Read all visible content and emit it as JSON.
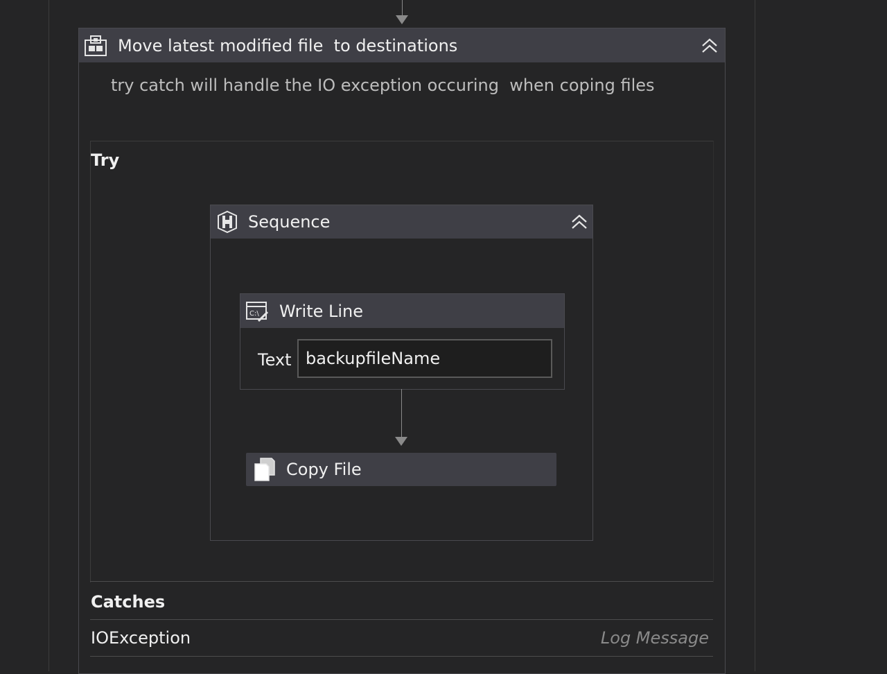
{
  "trycatch": {
    "title": "Move latest modified file  to destinations",
    "icon": "trycatch-icon",
    "annotation": "try catch will handle the IO exception occuring  when coping files",
    "try_label": "Try",
    "catches_label": "Catches",
    "catches": [
      {
        "exception": "IOException",
        "action_placeholder": "Log Message"
      }
    ]
  },
  "sequence": {
    "title": "Sequence",
    "icon": "sequence-icon"
  },
  "writeline": {
    "title": "Write Line",
    "icon": "writeline-icon",
    "text_label": "Text",
    "text_value": "backupfileName"
  },
  "copyfile": {
    "title": "Copy File",
    "icon": "copy-file-icon"
  },
  "colors": {
    "background": "#252526",
    "header": "#3f3f46",
    "connector": "#8a8a8a"
  }
}
